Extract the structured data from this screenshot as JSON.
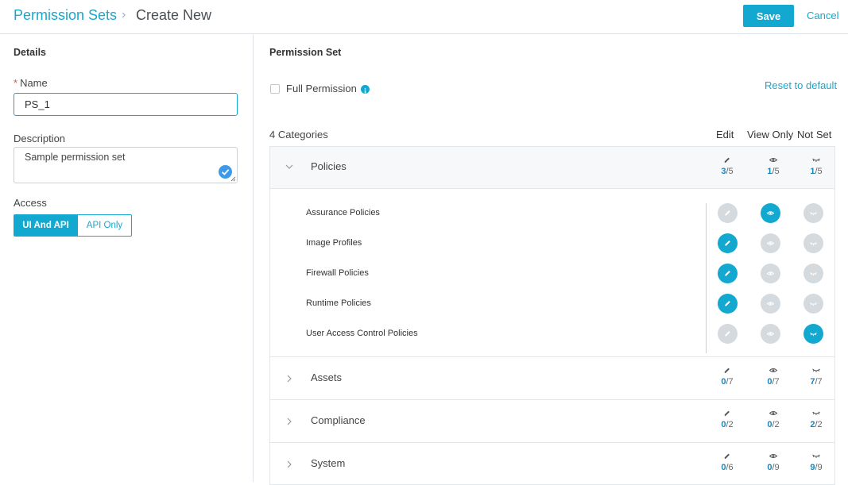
{
  "breadcrumb": {
    "parent": "Permission Sets",
    "current": "Create New"
  },
  "actions": {
    "save": "Save",
    "cancel": "Cancel"
  },
  "details": {
    "title": "Details",
    "name_label": "Name",
    "name_value": "PS_1",
    "description_label": "Description",
    "description_value": "Sample permission set",
    "access_label": "Access",
    "access_options": [
      "UI And API",
      "API Only"
    ],
    "access_selected": "UI And API"
  },
  "permission_set": {
    "title": "Permission Set",
    "full_permission_label": "Full Permission",
    "full_permission_checked": false,
    "reset_label": "Reset to default",
    "categories_count": "4 Categories",
    "columns": [
      "Edit",
      "View Only",
      "Not Set"
    ],
    "categories": [
      {
        "name": "Policies",
        "expanded": true,
        "counts": {
          "edit": [
            "3",
            "/5"
          ],
          "view": [
            "1",
            "/5"
          ],
          "notset": [
            "1",
            "/5"
          ]
        },
        "items": [
          {
            "name": "Assurance Policies",
            "state": "view"
          },
          {
            "name": "Image Profiles",
            "state": "edit"
          },
          {
            "name": "Firewall Policies",
            "state": "edit"
          },
          {
            "name": "Runtime Policies",
            "state": "edit"
          },
          {
            "name": "User Access Control Policies",
            "state": "notset"
          }
        ]
      },
      {
        "name": "Assets",
        "expanded": false,
        "counts": {
          "edit": [
            "0",
            "/7"
          ],
          "view": [
            "0",
            "/7"
          ],
          "notset": [
            "7",
            "/7"
          ]
        }
      },
      {
        "name": "Compliance",
        "expanded": false,
        "counts": {
          "edit": [
            "0",
            "/2"
          ],
          "view": [
            "0",
            "/2"
          ],
          "notset": [
            "2",
            "/2"
          ]
        }
      },
      {
        "name": "System",
        "expanded": false,
        "counts": {
          "edit": [
            "0",
            "/6"
          ],
          "view": [
            "0",
            "/9"
          ],
          "notset": [
            "9",
            "/9"
          ]
        }
      }
    ]
  },
  "colors": {
    "accent": "#13a8cf",
    "inactive": "#d5dadf",
    "link": "#1aa7cc"
  },
  "icons": {
    "edit": "pencil-icon",
    "view": "eye-icon",
    "notset": "closed-eye-icon"
  }
}
